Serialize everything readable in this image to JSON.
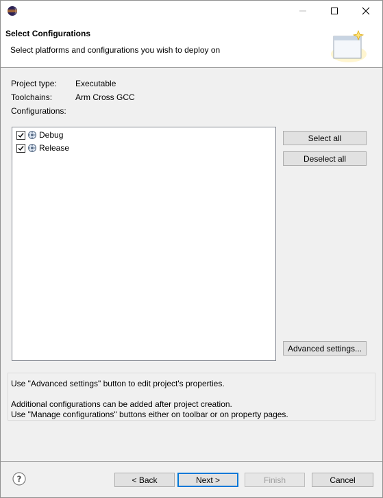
{
  "window": {
    "icon": "eclipse-icon",
    "controls": {
      "minimize": "minimize-icon",
      "maximize": "maximize-icon",
      "close": "close-icon"
    }
  },
  "header": {
    "title": "Select Configurations",
    "description": "Select platforms and configurations you wish to deploy on",
    "banner_icon": "wizard-banner-icon"
  },
  "project": {
    "type_label": "Project type:",
    "type_value": "Executable",
    "toolchains_label": "Toolchains:",
    "toolchains_value": "Arm Cross GCC",
    "configurations_label": "Configurations:"
  },
  "configurations": [
    {
      "label": "Debug",
      "checked": true,
      "icon": "configuration-icon"
    },
    {
      "label": "Release",
      "checked": true,
      "icon": "configuration-icon"
    }
  ],
  "side_buttons": {
    "select_all": "Select all",
    "deselect_all": "Deselect all",
    "advanced": "Advanced settings..."
  },
  "info": {
    "line1": "Use \"Advanced settings\" button to edit project's properties.",
    "line2": "Additional configurations can be added after project creation.",
    "line3": "Use \"Manage configurations\" buttons either on toolbar or on property pages."
  },
  "footer": {
    "help_icon": "help-icon",
    "back": "< Back",
    "next": "Next >",
    "finish": "Finish",
    "cancel": "Cancel"
  },
  "colors": {
    "focus_border": "#0078d7",
    "disabled_text": "#a0a0a0"
  }
}
